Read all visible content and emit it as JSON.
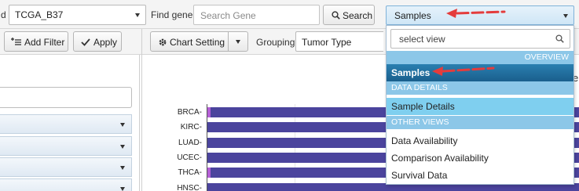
{
  "toolbar": {
    "cohort_label_partial": "d",
    "cohort_value": "TCGA_B37",
    "find_gene_label": "Find gene",
    "gene_search_placeholder": "Search Gene",
    "search_button_label": "Search"
  },
  "toolbar2": {
    "add_filter_label": "Add Filter",
    "apply_label": "Apply",
    "chart_setting_label": "Chart Setting",
    "grouping_label": "Grouping",
    "grouping_value": "Tumor Type"
  },
  "view_dropdown": {
    "selected": "Samples",
    "search_placeholder": "select view",
    "sections": {
      "overview": "OVERVIEW",
      "data_details": "DATA DETAILS",
      "other_views": "OTHER VIEWS"
    },
    "options": {
      "samples": "Samples",
      "sample_details": "Sample Details",
      "data_availability": "Data Availability",
      "comparison_availability": "Comparison Availability",
      "survival_data": "Survival Data"
    },
    "highlight_color": "#1f6d9e",
    "hover_color": "#7fcfef"
  },
  "chart_data": {
    "type": "bar",
    "orientation": "horizontal",
    "categories": [
      "BRCA",
      "KIRC",
      "LUAD",
      "UCEC",
      "THCA",
      "HNSC"
    ],
    "accent_colors": [
      "#b45fd6",
      "#4b449d",
      "#4b449d",
      "#4b449d",
      "#b45fd6",
      "#4b449d"
    ],
    "bar_color": "#4b449d",
    "partial_label_right": "e"
  }
}
